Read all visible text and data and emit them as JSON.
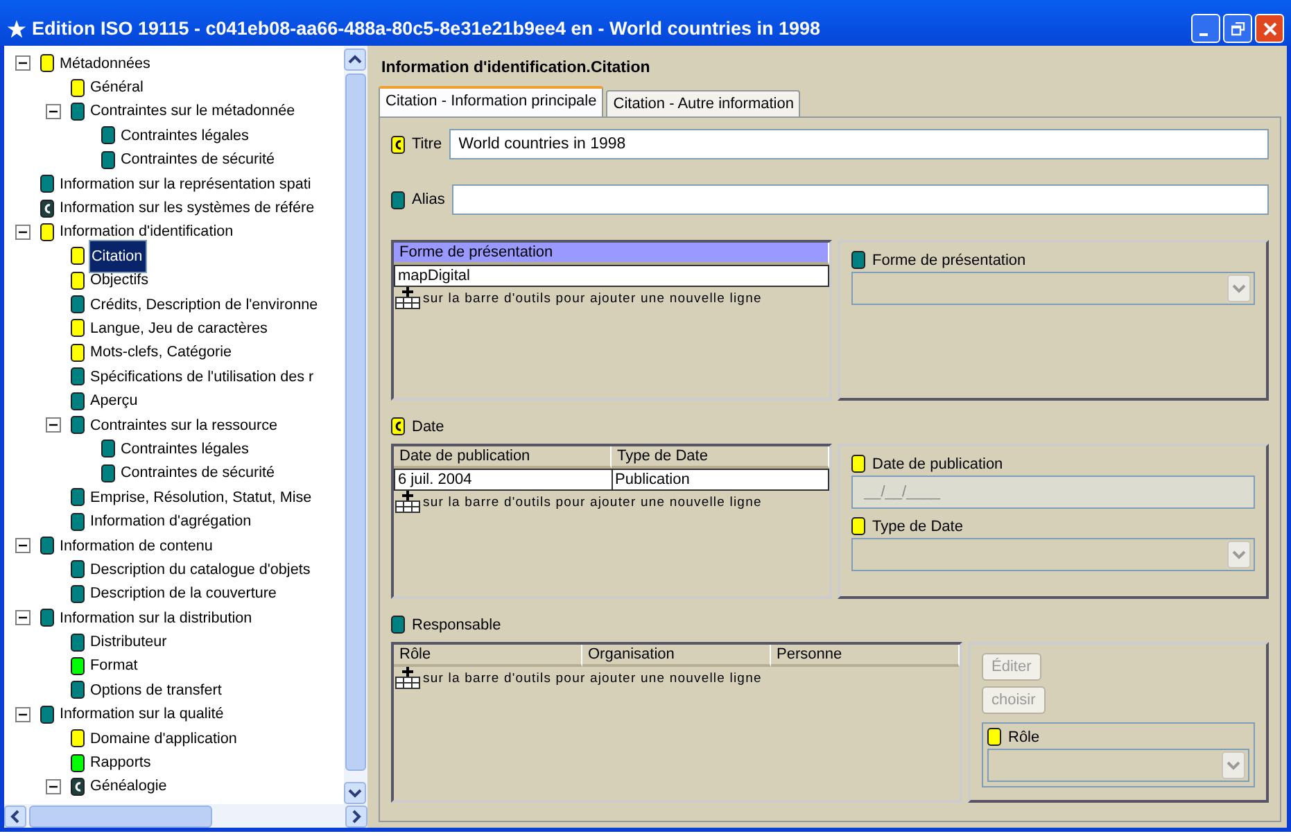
{
  "window": {
    "title": "Edition ISO 19115 - c041eb08-aa66-488a-80c5-8e31e21b9ee4 en - World countries in 1998"
  },
  "tree": [
    {
      "label": "Métadonnées",
      "color": "#ffff00",
      "conditional": false,
      "selected": false,
      "expanded": true,
      "children": [
        {
          "label": "Général",
          "color": "#ffff00",
          "conditional": false,
          "selected": false
        },
        {
          "label": "Contraintes sur le métadonnée",
          "color": "#008080",
          "conditional": false,
          "selected": false,
          "expanded": true,
          "children": [
            {
              "label": "Contraintes légales",
              "color": "#008080",
              "conditional": false,
              "selected": false
            },
            {
              "label": "Contraintes de sécurité",
              "color": "#008080",
              "conditional": false,
              "selected": false
            }
          ]
        }
      ]
    },
    {
      "label": "Information sur la représentation spati",
      "color": "#008080",
      "conditional": false,
      "selected": false
    },
    {
      "label": "Information sur les systèmes de référe",
      "color": "#1f3f3f",
      "conditional": true,
      "selected": false
    },
    {
      "label": "Information d'identification",
      "color": "#ffff00",
      "conditional": false,
      "selected": false,
      "expanded": true,
      "children": [
        {
          "label": "Citation",
          "color": "#ffff00",
          "conditional": false,
          "selected": true
        },
        {
          "label": "Objectifs",
          "color": "#ffff00",
          "conditional": false,
          "selected": false
        },
        {
          "label": "Crédits, Description de l'environne",
          "color": "#008080",
          "conditional": false,
          "selected": false
        },
        {
          "label": "Langue, Jeu de caractères",
          "color": "#ffff00",
          "conditional": false,
          "selected": false
        },
        {
          "label": "Mots-clefs, Catégorie",
          "color": "#ffff00",
          "conditional": false,
          "selected": false
        },
        {
          "label": "Spécifications de l'utilisation des r",
          "color": "#008080",
          "conditional": false,
          "selected": false
        },
        {
          "label": "Aperçu",
          "color": "#008080",
          "conditional": false,
          "selected": false
        },
        {
          "label": "Contraintes sur la ressource",
          "color": "#008080",
          "conditional": false,
          "selected": false,
          "expanded": true,
          "children": [
            {
              "label": "Contraintes légales",
              "color": "#008080",
              "conditional": false,
              "selected": false
            },
            {
              "label": "Contraintes de sécurité",
              "color": "#008080",
              "conditional": false,
              "selected": false
            }
          ]
        },
        {
          "label": "Emprise, Résolution, Statut, Mise",
          "color": "#008080",
          "conditional": false,
          "selected": false
        },
        {
          "label": "Information d'agrégation",
          "color": "#008080",
          "conditional": false,
          "selected": false
        }
      ]
    },
    {
      "label": "Information de contenu",
      "color": "#008080",
      "conditional": false,
      "selected": false,
      "expanded": true,
      "children": [
        {
          "label": "Description du catalogue d'objets",
          "color": "#008080",
          "conditional": false,
          "selected": false
        },
        {
          "label": "Description de la couverture",
          "color": "#008080",
          "conditional": false,
          "selected": false
        }
      ]
    },
    {
      "label": "Information sur la distribution",
      "color": "#008080",
      "conditional": false,
      "selected": false,
      "expanded": true,
      "children": [
        {
          "label": "Distributeur",
          "color": "#008080",
          "conditional": false,
          "selected": false
        },
        {
          "label": "Format",
          "color": "#00ff00",
          "conditional": false,
          "selected": false
        },
        {
          "label": "Options de transfert",
          "color": "#008080",
          "conditional": false,
          "selected": false
        }
      ]
    },
    {
      "label": "Information sur la qualité",
      "color": "#008080",
      "conditional": false,
      "selected": false,
      "expanded": true,
      "children": [
        {
          "label": "Domaine d'application",
          "color": "#ffff00",
          "conditional": false,
          "selected": false
        },
        {
          "label": "Rapports",
          "color": "#00ff00",
          "conditional": false,
          "selected": false
        },
        {
          "label": "Généalogie",
          "color": "#1f3f3f",
          "conditional": true,
          "selected": false,
          "expanded": true
        }
      ]
    }
  ],
  "heading": "Information d'identification.Citation",
  "tabs": [
    {
      "label": "Citation - Information principale",
      "selected": true
    },
    {
      "label": "Citation - Autre information",
      "selected": false
    }
  ],
  "fields": [
    {
      "label": "Titre",
      "color": "#ffff00",
      "conditional": true,
      "value": "World countries in 1998"
    },
    {
      "label": "Alias",
      "color": "#008080",
      "conditional": false
    }
  ],
  "sections": [
    {
      "table": {
        "columns": [
          {
            "label": "Forme de présentation",
            "selected": true
          }
        ],
        "rows": [
          [
            "mapDigital"
          ]
        ],
        "hint": "sur la barre d'outils pour ajouter une nouvelle ligne"
      },
      "editor": [
        {
          "kind": "select",
          "label": "Forme de présentation",
          "color": "#008080",
          "conditional": false,
          "disabled": true
        }
      ]
    },
    {
      "label": "Date",
      "color": "#ffff00",
      "conditional": true,
      "table": {
        "columns": [
          {
            "label": "Date de publication",
            "selected": false
          },
          {
            "label": "Type de Date",
            "selected": false
          }
        ],
        "rows": [
          [
            "6 juil. 2004",
            "Publication"
          ]
        ],
        "hint": "sur la barre d'outils pour ajouter une nouvelle ligne"
      },
      "editor": [
        {
          "kind": "masked",
          "label": "Date de publication",
          "color": "#ffff00",
          "conditional": false,
          "placeholder": "__/__/____",
          "disabled": true
        },
        {
          "kind": "select",
          "label": "Type de Date",
          "color": "#ffff00",
          "conditional": false,
          "disabled": true
        }
      ]
    },
    {
      "label": "Responsable",
      "color": "#008080",
      "conditional": false,
      "table": {
        "columns": [
          {
            "label": "Rôle",
            "selected": false
          },
          {
            "label": "Organisation",
            "selected": false
          },
          {
            "label": "Personne",
            "selected": false
          }
        ],
        "hint": "sur la barre d'outils pour ajouter une nouvelle ligne"
      },
      "buttons": [
        {
          "label": "Éditer",
          "disabled": true
        },
        {
          "label": "choisir",
          "disabled": true
        }
      ],
      "editor": [
        {
          "kind": "select",
          "label": "Rôle",
          "color": "#ffff00",
          "conditional": false,
          "disabled": true,
          "framed": true
        }
      ]
    }
  ]
}
